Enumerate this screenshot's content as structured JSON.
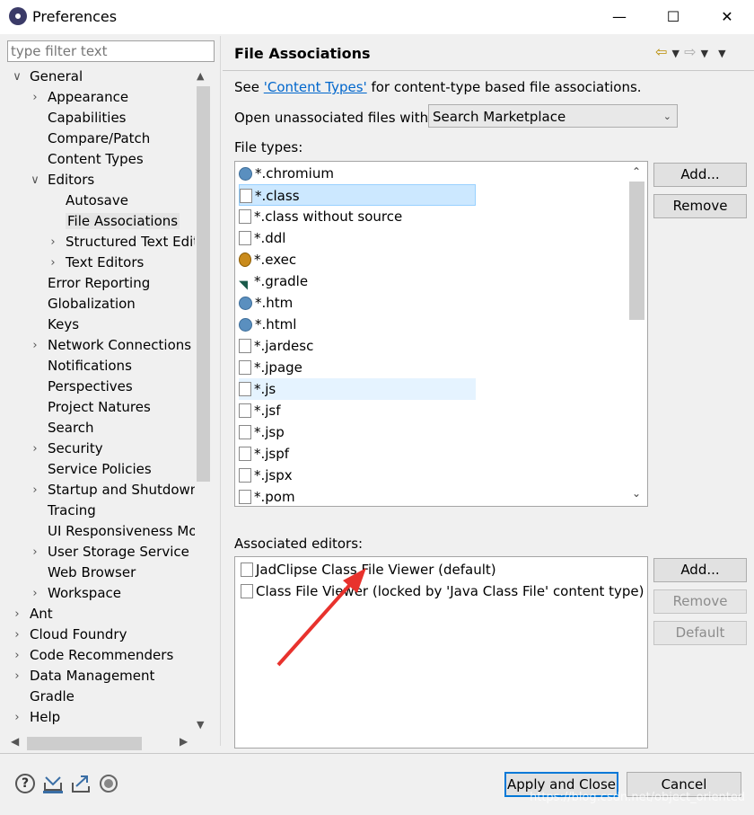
{
  "window": {
    "title": "Preferences",
    "controls": [
      "minimize",
      "maximize",
      "close"
    ]
  },
  "filter": {
    "placeholder": "type filter text"
  },
  "tree": [
    {
      "label": "General",
      "level": 0,
      "expander": "open"
    },
    {
      "label": "Appearance",
      "level": 1,
      "expander": "closed"
    },
    {
      "label": "Capabilities",
      "level": 1,
      "expander": "none"
    },
    {
      "label": "Compare/Patch",
      "level": 1,
      "expander": "none"
    },
    {
      "label": "Content Types",
      "level": 1,
      "expander": "none"
    },
    {
      "label": "Editors",
      "level": 1,
      "expander": "open"
    },
    {
      "label": "Autosave",
      "level": 2,
      "expander": "none"
    },
    {
      "label": "File Associations",
      "level": 2,
      "expander": "none",
      "selected": true
    },
    {
      "label": "Structured Text Edit",
      "level": 2,
      "expander": "closed"
    },
    {
      "label": "Text Editors",
      "level": 2,
      "expander": "closed"
    },
    {
      "label": "Error Reporting",
      "level": 1,
      "expander": "none"
    },
    {
      "label": "Globalization",
      "level": 1,
      "expander": "none"
    },
    {
      "label": "Keys",
      "level": 1,
      "expander": "none"
    },
    {
      "label": "Network Connections",
      "level": 1,
      "expander": "closed"
    },
    {
      "label": "Notifications",
      "level": 1,
      "expander": "none"
    },
    {
      "label": "Perspectives",
      "level": 1,
      "expander": "none"
    },
    {
      "label": "Project Natures",
      "level": 1,
      "expander": "none"
    },
    {
      "label": "Search",
      "level": 1,
      "expander": "none"
    },
    {
      "label": "Security",
      "level": 1,
      "expander": "closed"
    },
    {
      "label": "Service Policies",
      "level": 1,
      "expander": "none"
    },
    {
      "label": "Startup and Shutdown",
      "level": 1,
      "expander": "closed"
    },
    {
      "label": "Tracing",
      "level": 1,
      "expander": "none"
    },
    {
      "label": "UI Responsiveness Mo",
      "level": 1,
      "expander": "none"
    },
    {
      "label": "User Storage Service",
      "level": 1,
      "expander": "closed"
    },
    {
      "label": "Web Browser",
      "level": 1,
      "expander": "none"
    },
    {
      "label": "Workspace",
      "level": 1,
      "expander": "closed"
    },
    {
      "label": "Ant",
      "level": 0,
      "expander": "closed"
    },
    {
      "label": "Cloud Foundry",
      "level": 0,
      "expander": "closed"
    },
    {
      "label": "Code Recommenders",
      "level": 0,
      "expander": "closed"
    },
    {
      "label": "Data Management",
      "level": 0,
      "expander": "closed"
    },
    {
      "label": "Gradle",
      "level": 0,
      "expander": "none"
    },
    {
      "label": "Help",
      "level": 0,
      "expander": "closed"
    }
  ],
  "page": {
    "title": "File Associations",
    "see_prefix": "See ",
    "see_link": "'Content Types'",
    "see_suffix": " for content-type based file associations.",
    "open_unassoc_label": "Open unassociated files with:",
    "open_unassoc_value": "Search Marketplace",
    "file_types_label": "File types:",
    "associated_editors_label": "Associated editors:"
  },
  "file_types": [
    {
      "label": "*.chromium",
      "icon": "globe-icon"
    },
    {
      "label": "*.class",
      "icon": "class-file-icon",
      "selected": true
    },
    {
      "label": "*.class without source",
      "icon": "class-file-icon"
    },
    {
      "label": "*.ddl",
      "icon": "table-file-icon"
    },
    {
      "label": "*.exec",
      "icon": "gear-icon"
    },
    {
      "label": "*.gradle",
      "icon": "gradle-icon"
    },
    {
      "label": "*.htm",
      "icon": "globe-icon"
    },
    {
      "label": "*.html",
      "icon": "globe-icon"
    },
    {
      "label": "*.jardesc",
      "icon": "jar-icon"
    },
    {
      "label": "*.jpage",
      "icon": "jpage-icon"
    },
    {
      "label": "*.js",
      "icon": "js-file-icon",
      "highlighted": true
    },
    {
      "label": "*.jsf",
      "icon": "text-file-icon"
    },
    {
      "label": "*.jsp",
      "icon": "text-file-icon"
    },
    {
      "label": "*.jspf",
      "icon": "text-file-icon"
    },
    {
      "label": "*.jspx",
      "icon": "text-file-icon"
    },
    {
      "label": "*.pom",
      "icon": "pom-file-icon"
    }
  ],
  "file_type_buttons": {
    "add": "Add...",
    "remove": "Remove"
  },
  "associated_editors": [
    {
      "label": "JadClipse Class File Viewer (default)",
      "icon": "class-file-icon"
    },
    {
      "label": "Class File Viewer (locked by 'Java Class File' content type)",
      "icon": "class-file-icon"
    }
  ],
  "editor_buttons": {
    "add": "Add...",
    "remove": "Remove",
    "default": "Default"
  },
  "footer": {
    "apply_close": "Apply and Close",
    "cancel": "Cancel"
  },
  "watermark": "https://blog.csdn.net/object_oriented",
  "colors": {
    "selection": "#cce8ff",
    "focus_border": "#0078d7",
    "link": "#0066cc"
  }
}
